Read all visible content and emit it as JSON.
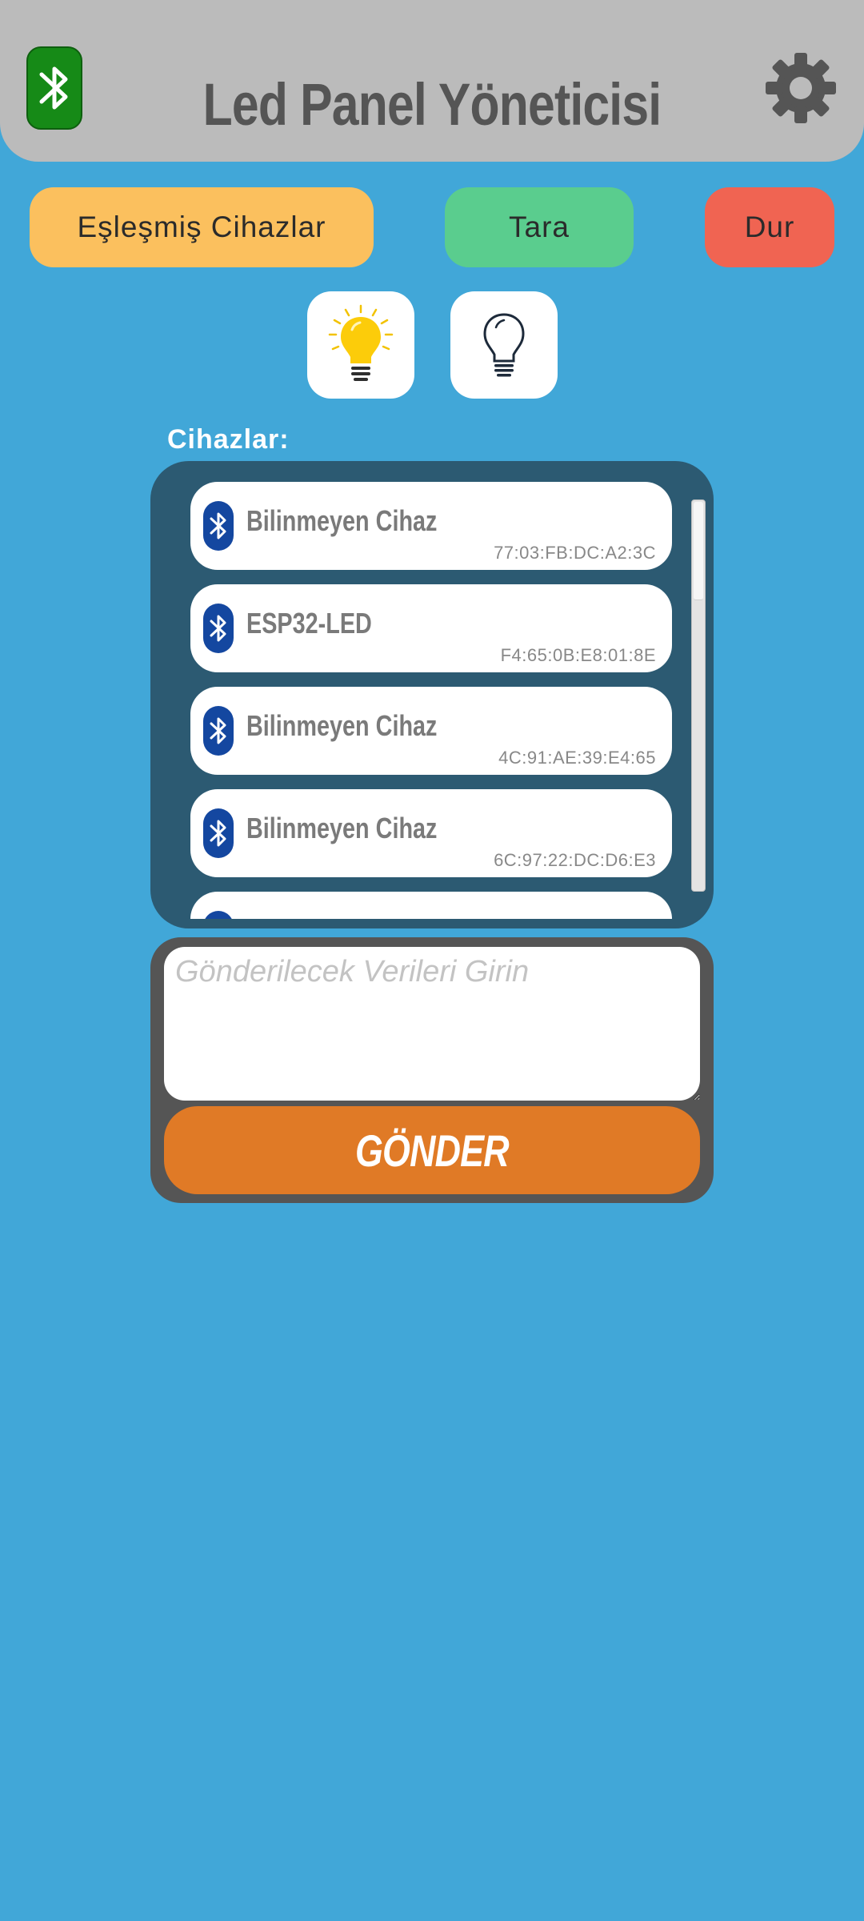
{
  "header": {
    "title": "Led Panel Yöneticisi",
    "status_icon": "bluetooth-icon",
    "settings_icon": "gear-icon"
  },
  "actions": {
    "paired_label": "Eşleşmiş Cihazlar",
    "scan_label": "Tara",
    "stop_label": "Dur"
  },
  "lights": {
    "on_icon": "lightbulb-on-icon",
    "off_icon": "lightbulb-off-icon"
  },
  "devices": {
    "label": "Cihazlar:",
    "items": [
      {
        "name": "Bilinmeyen Cihaz",
        "mac": "77:03:FB:DC:A2:3C"
      },
      {
        "name": "ESP32-LED",
        "mac": "F4:65:0B:E8:01:8E"
      },
      {
        "name": "Bilinmeyen Cihaz",
        "mac": "4C:91:AE:39:E4:65"
      },
      {
        "name": "Bilinmeyen Cihaz",
        "mac": "6C:97:22:DC:D6:E3"
      }
    ]
  },
  "send": {
    "placeholder": "Gönderilecek Verileri Girin",
    "button_label": "GÖNDER"
  },
  "colors": {
    "background": "#41a7d8",
    "header": "#bbbbbb",
    "paired_button": "#fbc05e",
    "scan_button": "#5acd8e",
    "stop_button": "#f06452",
    "device_panel": "#2c5a72",
    "send_button": "#e07a26",
    "bt_connected": "#168a17"
  }
}
